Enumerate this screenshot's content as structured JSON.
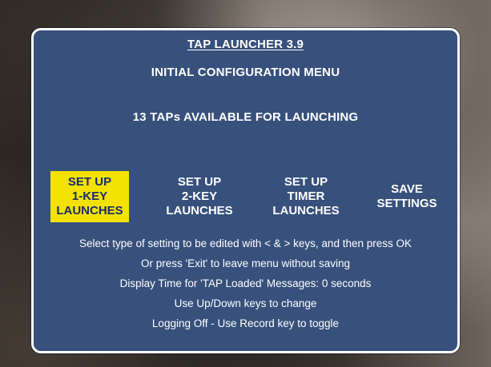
{
  "menu": {
    "title": "TAP LAUNCHER 3.9",
    "subtitle": "INITIAL CONFIGURATION MENU",
    "available": "13 TAPs AVAILABLE FOR LAUNCHING",
    "highlight_color": "#f4e300",
    "panel_color": "#37507c",
    "options": [
      {
        "lines": [
          "SET UP",
          "1-KEY",
          "LAUNCHES"
        ],
        "selected": true
      },
      {
        "lines": [
          "SET UP",
          "2-KEY",
          "LAUNCHES"
        ],
        "selected": false
      },
      {
        "lines": [
          "SET UP",
          "TIMER",
          "LAUNCHES"
        ],
        "selected": false
      },
      {
        "lines": [
          "SAVE",
          "SETTINGS"
        ],
        "selected": false
      }
    ],
    "instructions": [
      "Select type of setting to be edited with < & > keys, and then press OK",
      "Or press 'Exit' to leave menu without saving",
      "Display Time for 'TAP Loaded' Messages: 0 seconds",
      "Use Up/Down keys to change",
      "Logging Off - Use Record key to toggle"
    ]
  }
}
